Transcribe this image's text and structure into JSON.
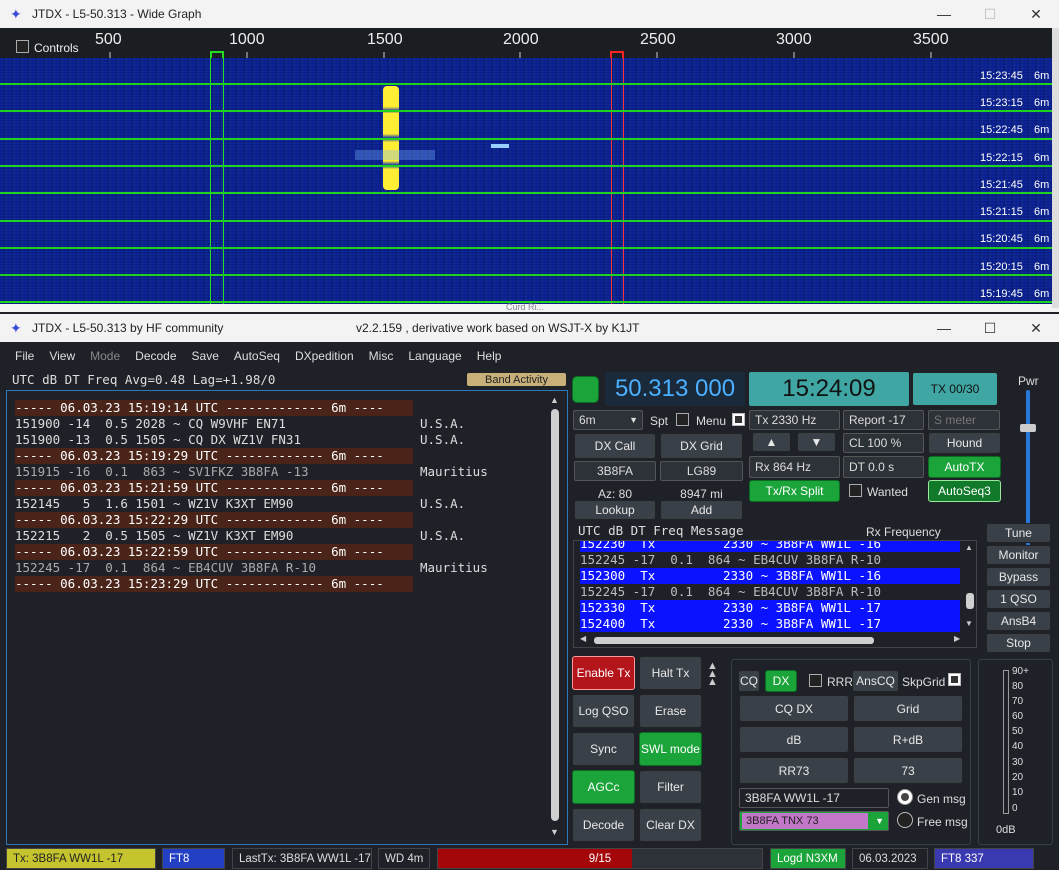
{
  "wide": {
    "title": "JTDX - L5-50.313 - Wide Graph",
    "controls_label": "Controls",
    "scale": [
      "500",
      "1000",
      "1500",
      "2000",
      "2500",
      "3000",
      "3500"
    ],
    "rows": [
      {
        "time": "15:23:45",
        "band": "6m"
      },
      {
        "time": "15:23:15",
        "band": "6m"
      },
      {
        "time": "15:22:45",
        "band": "6m"
      },
      {
        "time": "15:22:15",
        "band": "6m"
      },
      {
        "time": "15:21:45",
        "band": "6m"
      },
      {
        "time": "15:21:15",
        "band": "6m"
      },
      {
        "time": "15:20:45",
        "band": "6m"
      },
      {
        "time": "15:20:15",
        "band": "6m"
      },
      {
        "time": "15:19:45",
        "band": "6m"
      }
    ],
    "bottom_text": "Curd Ri..."
  },
  "main": {
    "title": "JTDX - L5-50.313   by HF community",
    "title_version": "v2.2.159 , derivative work based on WSJT-X by K1JT",
    "menu": [
      "File",
      "View",
      "Mode",
      "Decode",
      "Save",
      "AutoSeq",
      "DXpedition",
      "Misc",
      "Language",
      "Help"
    ],
    "band_header": "UTC      dB   DT Freq    Avg=0.48 Lag=+1.98/0",
    "band_activity": "Band Activity",
    "decodes": [
      {
        "text": "----- 06.03.23 15:19:14 UTC ------------- 6m ----",
        "sep": true,
        "country": ""
      },
      {
        "text": "151900 -14  0.5 2028 ~ CQ W9VHF EN71",
        "sep": false,
        "country": "U.S.A."
      },
      {
        "text": "151900 -13  0.5 1505 ~ CQ DX WZ1V FN31",
        "sep": false,
        "country": "U.S.A."
      },
      {
        "text": "----- 06.03.23 15:19:29 UTC ------------- 6m ----",
        "sep": true,
        "country": ""
      },
      {
        "text": "151915 -16  0.1  863 ~ SV1FKZ 3B8FA -13",
        "sep": false,
        "country": "Mauritius",
        "gray": true
      },
      {
        "text": "----- 06.03.23 15:21:59 UTC ------------- 6m ----",
        "sep": true,
        "country": ""
      },
      {
        "text": "152145   5  1.6 1501 ~ WZ1V K3XT EM90",
        "sep": false,
        "country": "U.S.A."
      },
      {
        "text": "----- 06.03.23 15:22:29 UTC ------------- 6m ----",
        "sep": true,
        "country": ""
      },
      {
        "text": "152215   2  0.5 1505 ~ WZ1V K3XT EM90",
        "sep": false,
        "country": "U.S.A."
      },
      {
        "text": "----- 06.03.23 15:22:59 UTC ------------- 6m ----",
        "sep": true,
        "country": ""
      },
      {
        "text": "152245 -17  0.1  864 ~ EB4CUV 3B8FA R-10",
        "sep": false,
        "country": "Mauritius",
        "gray": true
      },
      {
        "text": "----- 06.03.23 15:23:29 UTC ------------- 6m ----",
        "sep": true,
        "country": ""
      }
    ],
    "freq": "50.313 000",
    "clock": "15:24:09",
    "tx_count": "TX 00/30",
    "pwr": "Pwr",
    "band": "6m",
    "spt": "Spt",
    "menu_label": "Menu",
    "tx_hz": "Tx  2330  Hz",
    "report": "Report -17",
    "smeter": "S meter",
    "dx_call_btn": "DX Call",
    "dx_grid_btn": "DX Grid",
    "dx_call": "3B8FA",
    "dx_grid": "LG89",
    "az": "Az: 80",
    "dist": "8947 mi",
    "lookup": "Lookup",
    "add": "Add",
    "up": "▲",
    "down": "▼",
    "cl": "CL  100 %",
    "hound": "Hound",
    "rx_hz": "Rx  864  Hz",
    "dt": "DT 0.0 s",
    "autotx": "AutoTX",
    "split": "Tx/Rx Split",
    "wanted": "Wanted",
    "autoseq3": "AutoSeq3",
    "rx_header": "UTC     dB    DT  Freq     Message",
    "rx_freq_label": "Rx Frequency",
    "rx_rows": [
      {
        "text": "152230  Tx         2330 ~ 3B8FA WW1L -16",
        "tx": true
      },
      {
        "text": "152245 -17  0.1  864 ~ EB4CUV 3B8FA R-10",
        "tx": false
      },
      {
        "text": "152300  Tx         2330 ~ 3B8FA WW1L -16",
        "tx": true
      },
      {
        "text": "152245 -17  0.1  864 ~ EB4CUV 3B8FA R-10",
        "tx": false
      },
      {
        "text": "152330  Tx         2330 ~ 3B8FA WW1L -17",
        "tx": true
      },
      {
        "text": "152400  Tx         2330 ~ 3B8FA WW1L -17",
        "tx": true
      }
    ],
    "side_buttons": [
      "Tune",
      "Monitor",
      "Bypass",
      "1 QSO",
      "AnsB4",
      "Stop"
    ],
    "enable_tx": "Enable Tx",
    "halt_tx": "Halt Tx",
    "log_qso": "Log QSO",
    "erase": "Erase",
    "sync": "Sync",
    "swl": "SWL mode",
    "agcc": "AGCc",
    "filter": "Filter",
    "decode": "Decode",
    "clear_dx": "Clear DX",
    "cq": "CQ",
    "dx": "DX",
    "rrr": "RRR",
    "anscq": "AnsCQ",
    "skpgrid": "SkpGrid",
    "cq_dx": "CQ DX",
    "grid": "Grid",
    "db": "dB",
    "r_db": "R+dB",
    "rr73": "RR73",
    "n73": "73",
    "gen_text": "3B8FA WW1L -17",
    "gen_msg": "Gen msg",
    "free_text": "3B8FA TNX 73",
    "free_msg": "Free msg",
    "meter_scale": [
      "90+",
      "80",
      "70",
      "60",
      "50",
      "40",
      "30",
      "20",
      "10",
      "0"
    ],
    "meter_label": "0dB"
  },
  "status": {
    "tx": "Tx: 3B8FA WW1L -17",
    "mode": "FT8",
    "lasttx": "LastTx: 3B8FA WW1L -17",
    "wd": "WD 4m",
    "progress_text": "9/15",
    "progress": 0.6,
    "logd": "Logd N3XM",
    "date": "06.03.2023",
    "ft8n": "FT8  337"
  }
}
